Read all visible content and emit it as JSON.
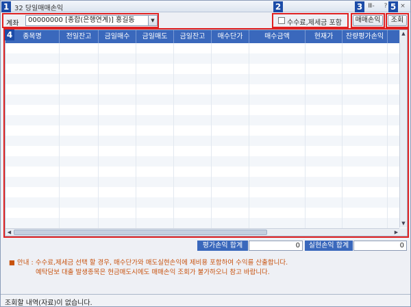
{
  "window": {
    "title": "32 당일매매손익",
    "menu_glyph": "Ⅲ-",
    "help_glyph": "?",
    "close_glyph": "×"
  },
  "badges": [
    "1",
    "2",
    "3",
    "4",
    "5"
  ],
  "account": {
    "label": "계좌",
    "value": "00000000 [종합(은행연계)] 홍길동",
    "arrow": "▼"
  },
  "include_fees": {
    "label": "수수료,제세금 포함",
    "checked": false
  },
  "buttons": {
    "pnl": "매매손익",
    "query": "조회"
  },
  "grid": {
    "columns": [
      "종목명",
      "전일잔고",
      "금일매수",
      "금일매도",
      "금일잔고",
      "매수단가",
      "매수금액",
      "현재가",
      "잔량평가손익"
    ],
    "row_count": 18,
    "scroll": {
      "up": "▲",
      "down": "▼",
      "left": "◀",
      "right": "▶"
    }
  },
  "summary": {
    "eval_label": "평가손익 합계",
    "eval_value": "0",
    "realized_label": "실현손익 합계",
    "realized_value": "0"
  },
  "notice": {
    "bullet": "■",
    "line1": "안내 : 수수료,제세금 선택 할 경우, 매수단가와 매도실현손익에 제비용 포함하여 수익를 산출합니다.",
    "line2": "예탁담보 대출 발생종목은 현금매도시에도 매매손익 조회가 불가하오니 참고 바랍니다."
  },
  "status": {
    "message": "조회할 내역(자료)이 없습니다."
  },
  "colors": {
    "header": "#3a68bc",
    "badge": "#1c4ca8",
    "highlight": "#e02020",
    "notice": "#c8520e"
  }
}
